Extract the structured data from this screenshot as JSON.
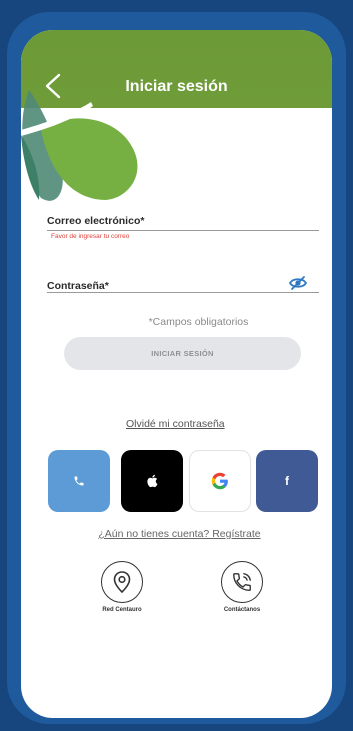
{
  "header": {
    "title": "Iniciar sesión"
  },
  "form": {
    "email_label": "Correo electrónico*",
    "email_error": "Favor de ingresar tu correo",
    "password_label": "Contraseña*",
    "required_note": "*Campos obligatorios",
    "submit_label": "INICIAR SESIÓN"
  },
  "links": {
    "forgot_password": "Olvidé mi contraseña",
    "register": "¿Aún no tienes cuenta? Regístrate"
  },
  "social": {
    "facebook_glyph": "f"
  },
  "bottom_nav": {
    "network_label": "Red Centauro",
    "contact_label": "Contáctanos"
  },
  "colors": {
    "header": "#6f9c38",
    "frame": "#1f5a9d",
    "background": "#16467d",
    "error": "#e0413a"
  }
}
